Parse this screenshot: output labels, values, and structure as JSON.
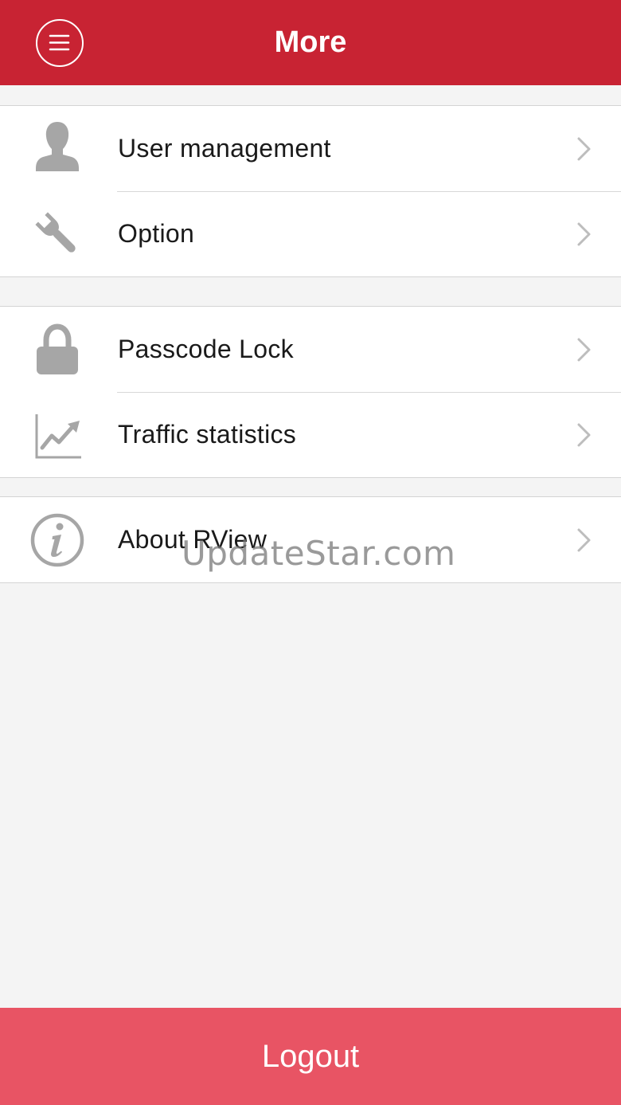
{
  "header": {
    "title": "More",
    "menu_icon": "menu-circle-icon",
    "background": "#c82333"
  },
  "groups": [
    {
      "items": [
        {
          "label": "User management",
          "icon": "user-icon"
        },
        {
          "label": "Option",
          "icon": "wrench-icon"
        }
      ]
    },
    {
      "items": [
        {
          "label": "Passcode Lock",
          "icon": "lock-icon"
        },
        {
          "label": "Traffic statistics",
          "icon": "chart-icon"
        }
      ]
    },
    {
      "items": [
        {
          "label": "About RView",
          "icon": "info-icon"
        }
      ]
    }
  ],
  "watermark": "UpdateStar.com",
  "logout": {
    "label": "Logout",
    "background": "#e85464"
  },
  "colors": {
    "icon": "#a6a6a6",
    "chevron": "#bdbdbd",
    "background": "#f4f4f4"
  }
}
